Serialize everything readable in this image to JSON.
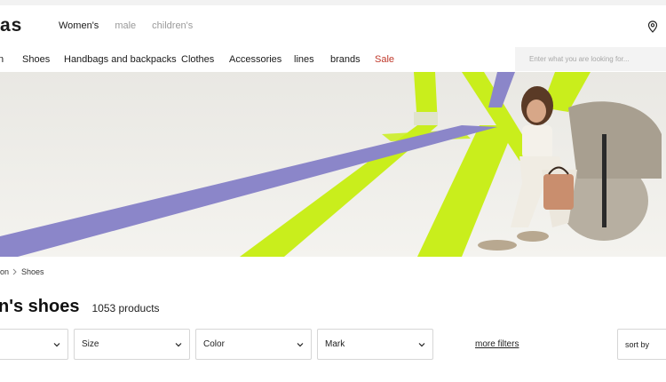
{
  "header": {
    "logo_text": "as",
    "gender_tabs": [
      {
        "label": "Women's",
        "active": true
      },
      {
        "label": "male",
        "active": false
      },
      {
        "label": "children's",
        "active": false
      }
    ],
    "location_icon": "map-pin-icon"
  },
  "categories": {
    "items": [
      "n",
      "Shoes",
      "Handbags and backpacks",
      "Clothes",
      "Accessories",
      "lines",
      "brands",
      "Sale"
    ],
    "sale_color": "#c0392b"
  },
  "search": {
    "placeholder": "Enter what you are looking for...",
    "value": ""
  },
  "breadcrumb": {
    "items": [
      "ion",
      "Shoes"
    ]
  },
  "listing": {
    "title": "n's shoes",
    "count": "1053 products"
  },
  "filters": {
    "items": [
      {
        "label": ""
      },
      {
        "label": "Size"
      },
      {
        "label": "Color"
      },
      {
        "label": "Mark"
      }
    ],
    "more_filters": "more filters",
    "sort_label": "sort by"
  },
  "colors": {
    "accent_lime": "#c9ee1c",
    "accent_violet": "#8b86c9"
  }
}
